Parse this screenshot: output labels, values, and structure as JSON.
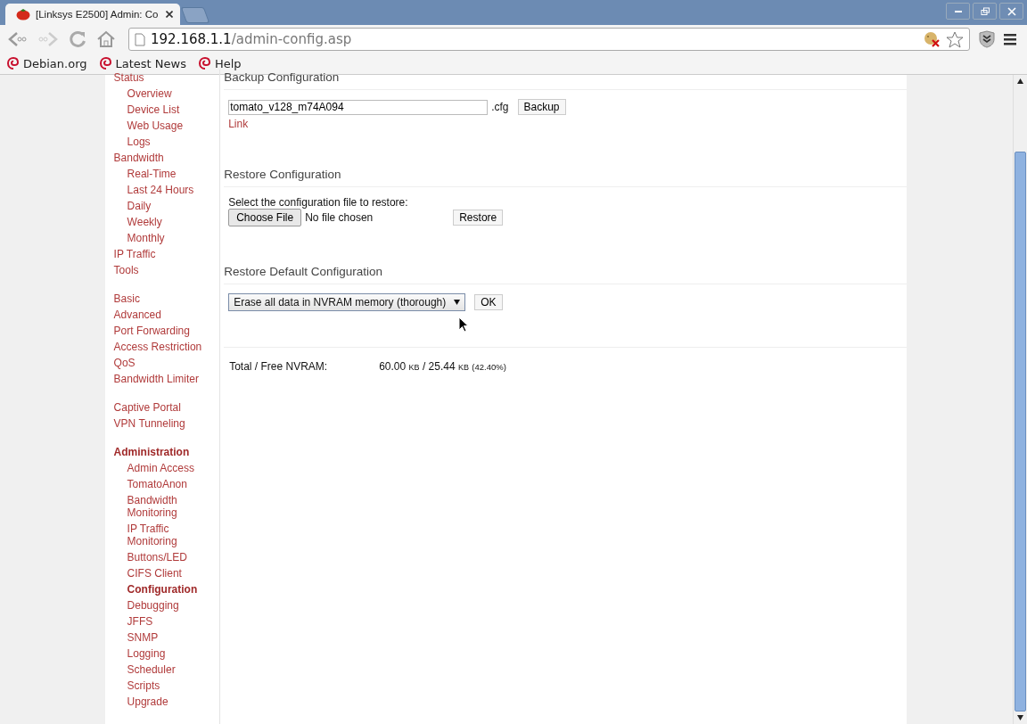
{
  "browser": {
    "tab_title": "[Linksys E2500] Admin: Co",
    "url_host": "192.168.1.1",
    "url_path": "/admin-config.asp",
    "bookmarks": [
      "Debian.org",
      "Latest News",
      "Help"
    ]
  },
  "sidebar": {
    "groups": [
      [
        {
          "label": "Status",
          "selected": false,
          "children": [
            {
              "label": "Overview",
              "selected": false
            },
            {
              "label": "Device List",
              "selected": false
            },
            {
              "label": "Web Usage",
              "selected": false
            },
            {
              "label": "Logs",
              "selected": false
            }
          ]
        },
        {
          "label": "Bandwidth",
          "selected": false,
          "children": [
            {
              "label": "Real-Time",
              "selected": false
            },
            {
              "label": "Last 24 Hours",
              "selected": false
            },
            {
              "label": "Daily",
              "selected": false
            },
            {
              "label": "Weekly",
              "selected": false
            },
            {
              "label": "Monthly",
              "selected": false
            }
          ]
        },
        {
          "label": "IP Traffic",
          "selected": false
        },
        {
          "label": "Tools",
          "selected": false
        }
      ],
      [
        {
          "label": "Basic",
          "selected": false
        },
        {
          "label": "Advanced",
          "selected": false
        },
        {
          "label": "Port Forwarding",
          "selected": false
        },
        {
          "label": "Access Restriction",
          "selected": false
        },
        {
          "label": "QoS",
          "selected": false
        },
        {
          "label": "Bandwidth Limiter",
          "selected": false
        }
      ],
      [
        {
          "label": "Captive Portal",
          "selected": false
        },
        {
          "label": "VPN Tunneling",
          "selected": false
        }
      ],
      [
        {
          "label": "Administration",
          "selected": true,
          "children": [
            {
              "label": "Admin Access",
              "selected": false
            },
            {
              "label": "TomatoAnon",
              "selected": false
            },
            {
              "label": "Bandwidth Monitoring",
              "selected": false
            },
            {
              "label": "IP Traffic Monitoring",
              "selected": false
            },
            {
              "label": "Buttons/LED",
              "selected": false
            },
            {
              "label": "CIFS Client",
              "selected": false
            },
            {
              "label": "Configuration",
              "selected": true
            },
            {
              "label": "Debugging",
              "selected": false
            },
            {
              "label": "JFFS",
              "selected": false
            },
            {
              "label": "SNMP",
              "selected": false
            },
            {
              "label": "Logging",
              "selected": false
            },
            {
              "label": "Scheduler",
              "selected": false
            },
            {
              "label": "Scripts",
              "selected": false
            },
            {
              "label": "Upgrade",
              "selected": false
            }
          ]
        }
      ]
    ]
  },
  "backup": {
    "title": "Backup Configuration",
    "filename": "tomato_v128_m74A094",
    "extension": ".cfg",
    "button": "Backup",
    "link": "Link"
  },
  "restore": {
    "title": "Restore Configuration",
    "prompt": "Select the configuration file to restore:",
    "file_button": "Choose File",
    "file_status": "No file chosen",
    "button": "Restore"
  },
  "restore_default": {
    "title": "Restore Default Configuration",
    "select_value": "Erase all data in NVRAM memory (thorough)",
    "button": "OK"
  },
  "nvram": {
    "label": "Total / Free NVRAM:",
    "value": [
      {
        "kind": "number",
        "text": "60.00"
      },
      {
        "kind": "unit",
        "text": "KB"
      },
      {
        "kind": "number",
        "text": "/ 25.44"
      },
      {
        "kind": "unit",
        "text": "KB"
      },
      {
        "kind": "note",
        "text": "(42.40%)"
      }
    ]
  }
}
